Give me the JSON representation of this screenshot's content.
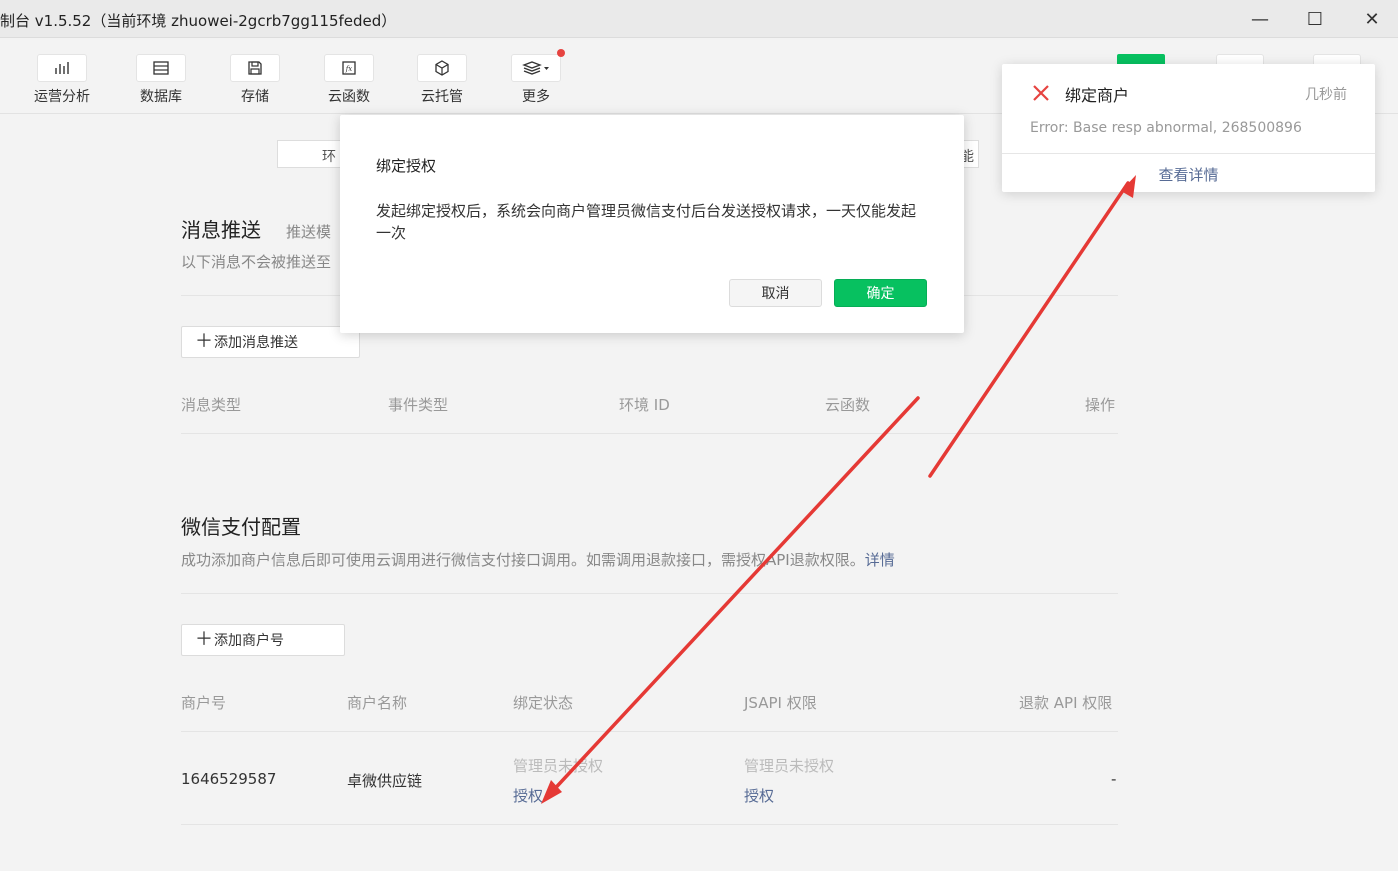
{
  "window": {
    "title": "制台 v1.5.52（当前环境 zhuowei-2gcrb7gg115feded）",
    "minimize": "—",
    "maximize": "☐",
    "close": "✕"
  },
  "toolbar": {
    "items": [
      {
        "label": "运营分析",
        "icon": "bar-chart-icon"
      },
      {
        "label": "数据库",
        "icon": "database-icon"
      },
      {
        "label": "存储",
        "icon": "save-icon"
      },
      {
        "label": "云函数",
        "icon": "function-icon"
      },
      {
        "label": "云托管",
        "icon": "cube-icon"
      },
      {
        "label": "更多",
        "icon": "layers-icon"
      }
    ]
  },
  "tabs": {
    "left_fragment": "环",
    "right_fragment": "能"
  },
  "message_push": {
    "title": "消息推送",
    "subtitle": "推送模",
    "desc": "以下消息不会被推送至",
    "add_button": "添加消息推送",
    "columns": [
      "消息类型",
      "事件类型",
      "环境 ID",
      "云函数",
      "操作"
    ]
  },
  "wechat_pay": {
    "title": "微信支付配置",
    "desc": "成功添加商户信息后即可使用云调用进行微信支付接口调用。如需调用退款接口，需授权API退款权限。",
    "desc_link": "详情",
    "add_button": "添加商户号",
    "columns": [
      "商户号",
      "商户名称",
      "绑定状态",
      "JSAPI 权限",
      "退款 API 权限"
    ],
    "rows": [
      {
        "merchant_id": "1646529587",
        "merchant_name": "卓微供应链",
        "bind_status": "管理员未授权",
        "bind_action": "授权",
        "jsapi_status": "管理员未授权",
        "jsapi_action": "授权",
        "refund": "-"
      }
    ]
  },
  "dialog": {
    "title": "绑定授权",
    "body": "发起绑定授权后，系统会向商户管理员微信支付后台发送授权请求，一天仅能发起一次",
    "cancel": "取消",
    "confirm": "确定"
  },
  "notification": {
    "title": "绑定商户",
    "time": "几秒前",
    "message": "Error: Base resp abnormal, 268500896",
    "link": "查看详情"
  },
  "colors": {
    "accent_green": "#07c160",
    "link_blue": "#576b95",
    "error_red": "#e64340",
    "arrow_red": "#e53935"
  }
}
